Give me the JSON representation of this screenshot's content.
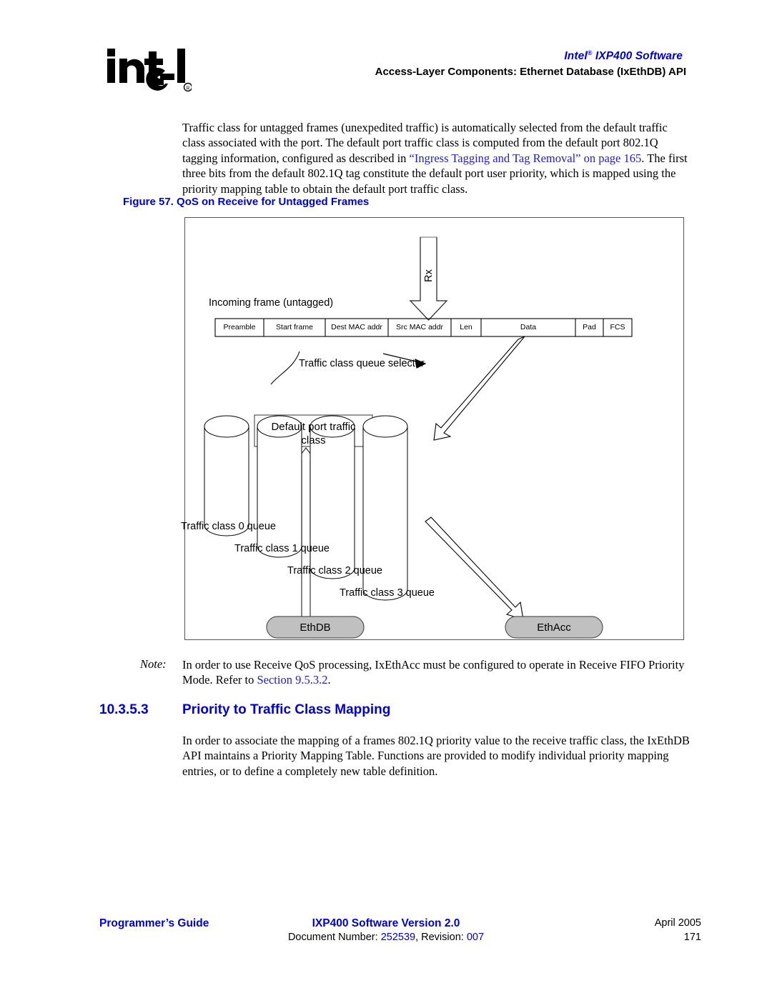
{
  "header": {
    "logo_alt": "intel",
    "product_line": "Intel",
    "product_line_reg": "®",
    "product_line_rest": " IXP400 Software",
    "subtitle": "Access-Layer Components: Ethernet Database (IxEthDB) API"
  },
  "intro_paragraph": {
    "seg1": "Traffic class for untagged frames (unexpedited traffic) is automatically selected from the default traffic class associated with the port. The default port traffic class is computed from the default port 802.1Q tagging information, configured as described in ",
    "link1": "“Ingress Tagging and Tag Removal” on page 165",
    "seg2": ". The first three bits from the default 802.1Q tag constitute the default port user priority, which is mapped using the priority mapping table to obtain the default port traffic class."
  },
  "figure": {
    "caption": "Figure 57. QoS on Receive for Untagged Frames",
    "rx_arrow_label": "Rx",
    "incoming_frame_label": "Incoming frame (untagged)",
    "frame_fields": [
      "Preamble",
      "Start frame",
      "Dest MAC addr",
      "Src MAC addr",
      "Len",
      "Data",
      "Pad",
      "FCS"
    ],
    "selector_label": "Traffic class queue selector",
    "default_port_box_line1": "Default port traffic",
    "default_port_box_line2": "class",
    "queue_labels": [
      "Traffic class 0 queue",
      "Traffic class 1 queue",
      "Traffic class 2 queue",
      "Traffic class 3 queue"
    ],
    "ethdb_box": "EthDB",
    "ethacc_box": "EthAcc",
    "colors": {
      "border": "#555555",
      "component_fill": "#C0C0C0",
      "arrow_fill": "#FFFFFF",
      "arrow_stroke": "#000000"
    }
  },
  "note": {
    "label": "Note:",
    "seg1": "In order to use Receive QoS processing, IxEthAcc must be configured to operate in Receive FIFO Priority Mode. Refer to ",
    "link1": "Section 9.5.3.2",
    "seg2": "."
  },
  "section": {
    "number": "10.3.5.3",
    "title": "Priority to Traffic Class Mapping",
    "paragraph": "In order to associate the mapping of a frames 802.1Q priority value to the receive traffic class, the IxEthDB API maintains a Priority Mapping Table. Functions are provided to modify individual priority mapping entries, or to define a completely new table definition."
  },
  "footer": {
    "left": "Programmer’s Guide",
    "center_line1": "IXP400 Software Version 2.0",
    "center_line2_pre": "Document Number: ",
    "center_line2_doc": "252539",
    "center_line2_mid": ", Revision: ",
    "center_line2_rev": "007",
    "right_date": "April 2005",
    "right_page": "171"
  },
  "colors": {
    "link_blue": "#2222BB",
    "heading_blue": "#0000CC",
    "text_black": "#000000"
  }
}
